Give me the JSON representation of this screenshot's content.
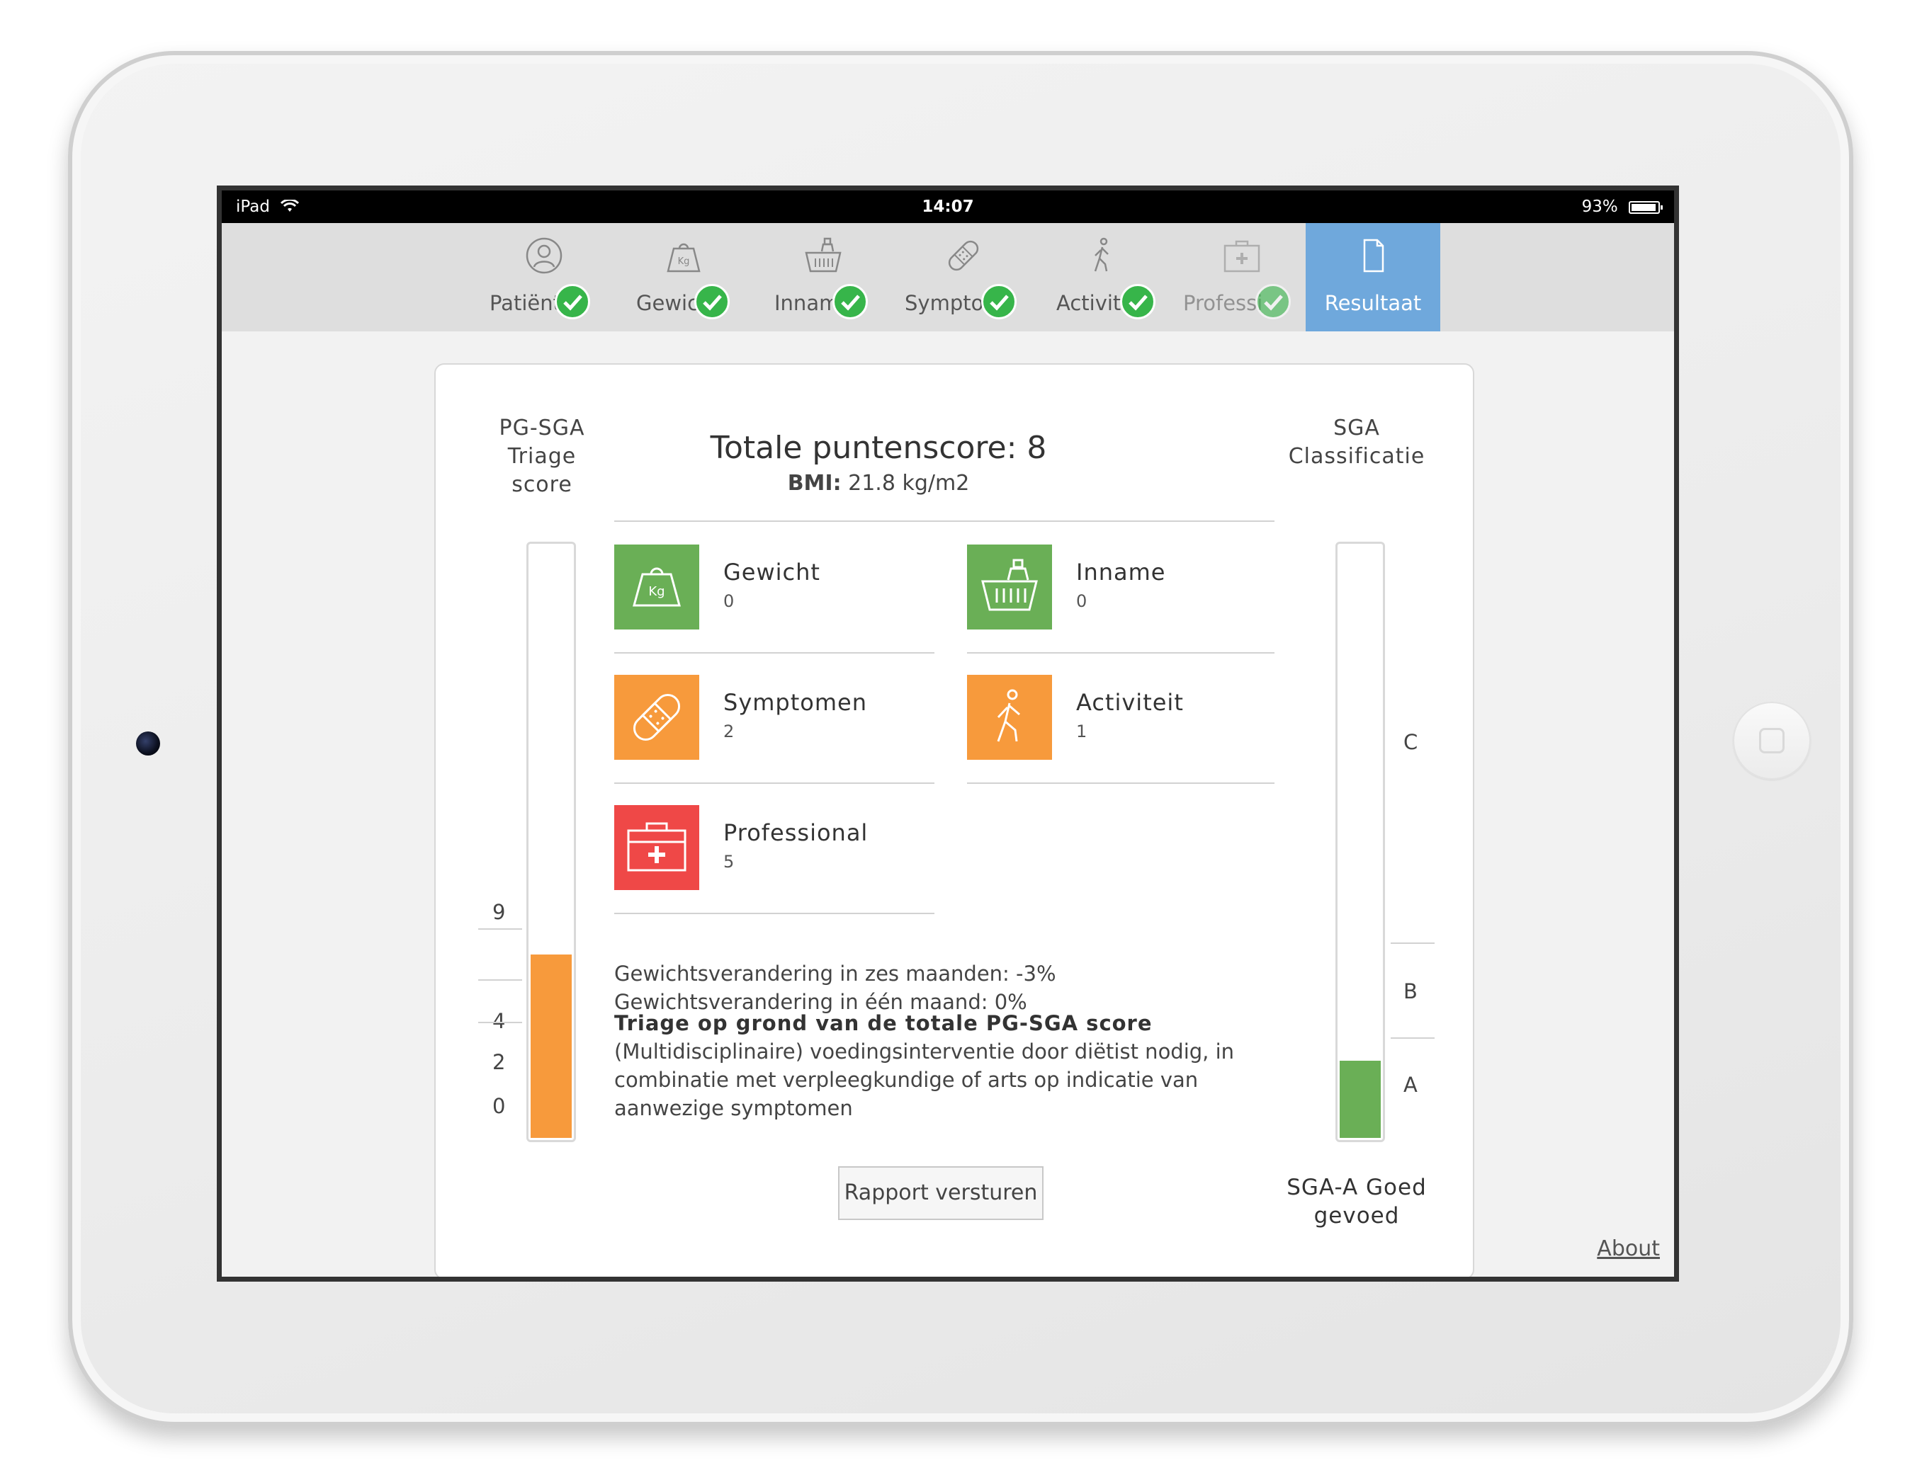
{
  "statusbar": {
    "device": "iPad",
    "time": "14:07",
    "battery": "93%"
  },
  "nav": {
    "items": [
      {
        "label": "Patiënt",
        "icon": "person-icon",
        "done": true
      },
      {
        "label": "Gewicht",
        "icon": "weight-icon",
        "done": true
      },
      {
        "label": "Inname",
        "icon": "basket-icon",
        "done": true
      },
      {
        "label": "Symptomen",
        "icon": "bandage-icon",
        "done": true
      },
      {
        "label": "Activiteit",
        "icon": "walking-icon",
        "done": true
      },
      {
        "label": "Professional",
        "icon": "first-aid-kit-icon",
        "done": true
      }
    ],
    "active": {
      "label": "Resultaat",
      "icon": "document-icon"
    }
  },
  "triage": {
    "title_line1": "PG-SGA",
    "title_line2": "Triage",
    "title_line3": "score",
    "ticks": [
      "9",
      "4",
      "2",
      "0"
    ],
    "level_fraction": 0.31,
    "color": "#f79a3c"
  },
  "summary": {
    "title": "Totale puntenscore: 8",
    "bmi_label": "BMI:",
    "bmi_value": "21.8 kg/m2"
  },
  "categories": [
    {
      "title": "Gewicht",
      "value": "0",
      "color": "#6aaf56",
      "icon": "weight-icon"
    },
    {
      "title": "Inname",
      "value": "0",
      "color": "#6aaf56",
      "icon": "basket-icon"
    },
    {
      "title": "Symptomen",
      "value": "2",
      "color": "#f79a3c",
      "icon": "bandage-icon"
    },
    {
      "title": "Activiteit",
      "value": "1",
      "color": "#f79a3c",
      "icon": "walking-icon"
    },
    {
      "title": "Professional",
      "value": "5",
      "color": "#ef4847",
      "icon": "first-aid-kit-icon"
    }
  ],
  "weight_change": {
    "six_months": "Gewichtsverandering in zes maanden: -3%",
    "one_month": "Gewichtsverandering in één maand: 0%"
  },
  "triage_text": {
    "title": "Triage op grond van de totale PG-SGA score",
    "body": "(Multidisciplinaire) voedingsinterventie door diëtist nodig, in combinatie met verpleegkundige of arts op indicatie van aanwezige symptomen"
  },
  "send_button": "Rapport versturen",
  "sga": {
    "title_line1": "SGA",
    "title_line2": "Classificatie",
    "levels": [
      "C",
      "B",
      "A"
    ],
    "level_fraction": 0.13,
    "color": "#6aaf56",
    "result_line1": "SGA-A Goed",
    "result_line2": "gevoed"
  },
  "about_link": "About"
}
